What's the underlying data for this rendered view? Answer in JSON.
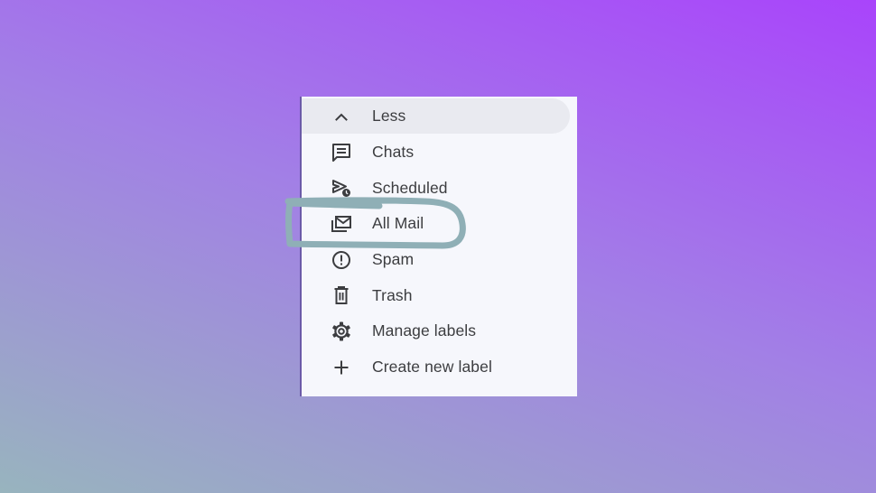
{
  "menu": {
    "items": [
      {
        "label": "Less",
        "icon": "chevron-up-icon"
      },
      {
        "label": "Chats",
        "icon": "chat-icon"
      },
      {
        "label": "Scheduled",
        "icon": "scheduled-send-icon"
      },
      {
        "label": "All Mail",
        "icon": "all-mail-icon"
      },
      {
        "label": "Spam",
        "icon": "spam-icon"
      },
      {
        "label": "Trash",
        "icon": "trash-icon"
      },
      {
        "label": "Manage labels",
        "icon": "gear-icon"
      },
      {
        "label": "Create new label",
        "icon": "plus-icon"
      }
    ]
  },
  "colors": {
    "panel_background": "#f6f7fc",
    "hover_background": "#e9eaf0",
    "text": "#3c3d40",
    "icon": "#3c3d40",
    "highlight_stroke": "#8fafb6"
  }
}
